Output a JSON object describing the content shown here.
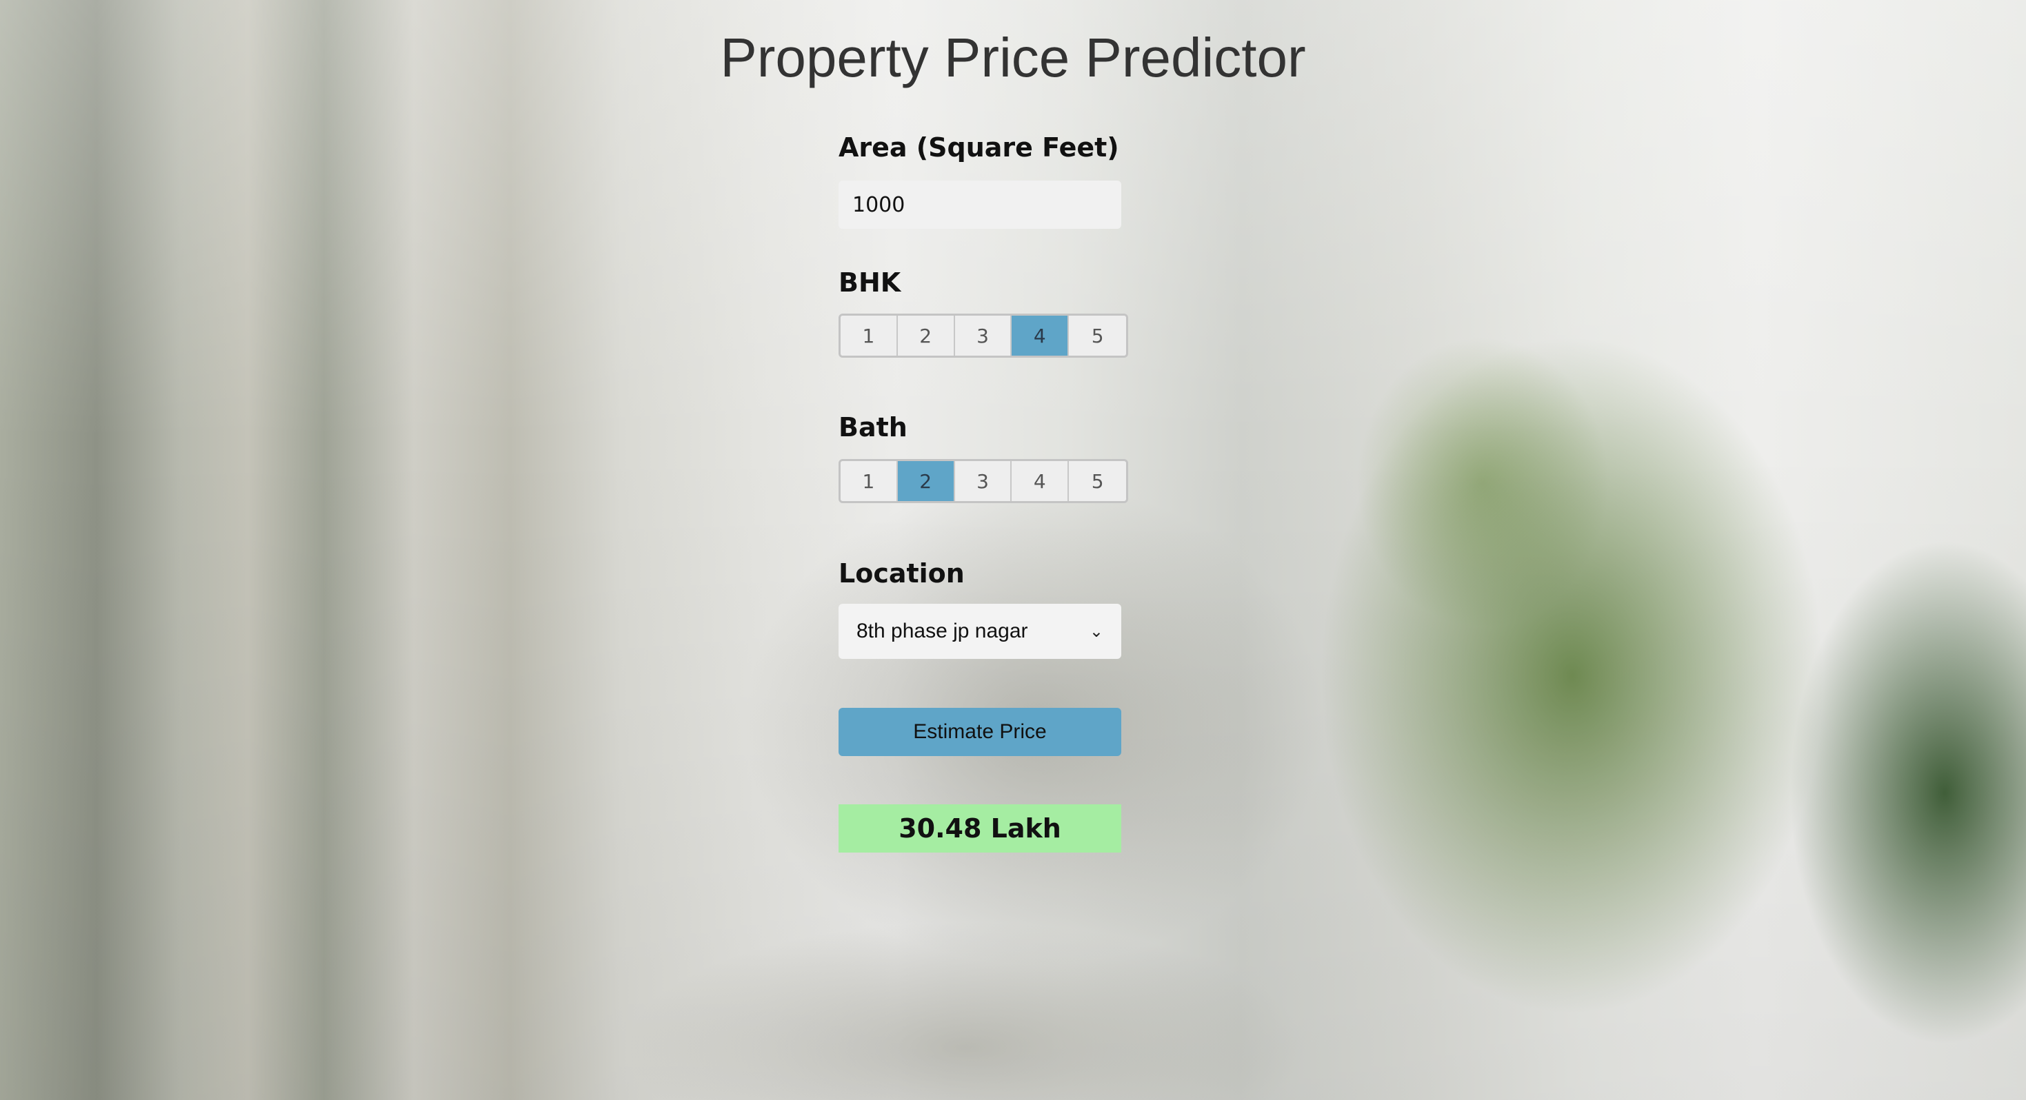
{
  "page": {
    "title": "Property Price Predictor"
  },
  "area": {
    "label": "Area (Square Feet)",
    "value": "1000"
  },
  "bhk": {
    "label": "BHK",
    "options": [
      "1",
      "2",
      "3",
      "4",
      "5"
    ],
    "selected": "4"
  },
  "bath": {
    "label": "Bath",
    "options": [
      "1",
      "2",
      "3",
      "4",
      "5"
    ],
    "selected": "2"
  },
  "location": {
    "label": "Location",
    "selected": "8th phase jp nagar"
  },
  "estimate_button": {
    "label": "Estimate Price"
  },
  "result": {
    "text": "30.48 Lakh"
  },
  "colors": {
    "accent": "#5fa5c8",
    "result_bg": "#a5eda2"
  }
}
